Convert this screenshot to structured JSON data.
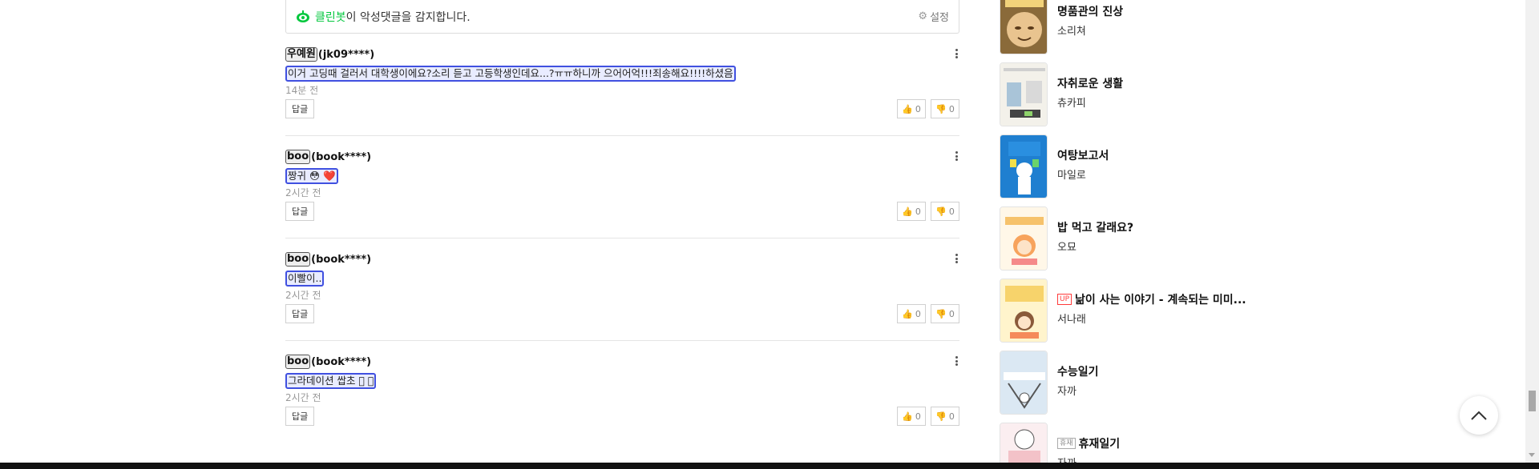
{
  "cleanbot": {
    "brand": "클린봇",
    "message": "이 악성댓글을 감지합니다.",
    "settings_label": "설정"
  },
  "comments": [
    {
      "nickname": "우예원",
      "user_id": "(jk09****)",
      "text": "이거 고딩때 걸러서 대학생이에요?소리 듣고 고등학생인데요...?ㅠㅠ하니까 으어어억!!!죄송해요!!!!하셨음",
      "time": "14분 전",
      "reply_label": "답글",
      "likes": "0",
      "dislikes": "0"
    },
    {
      "nickname": "boo",
      "user_id": "(book****)",
      "text": "짱귀 😳 ❤️",
      "time": "2시간 전",
      "reply_label": "답글",
      "likes": "0",
      "dislikes": "0"
    },
    {
      "nickname": "boo",
      "user_id": "(book****)",
      "text": "이빨이..",
      "time": "2시간 전",
      "reply_label": "답글",
      "likes": "0",
      "dislikes": "0"
    },
    {
      "nickname": "boo",
      "user_id": "(book****)",
      "text": "그라데이션 쌉초 🏻 🏼",
      "time": "2시간 전",
      "reply_label": "답글",
      "likes": "0",
      "dislikes": "0"
    }
  ],
  "side_list": [
    {
      "title": "명품관의 진상",
      "author": "소리쳐",
      "badge": ""
    },
    {
      "title": "자취로운 생활",
      "author": "츄카피",
      "badge": ""
    },
    {
      "title": "여탕보고서",
      "author": "마일로",
      "badge": ""
    },
    {
      "title": "밥 먹고 갈래요?",
      "author": "오묘",
      "badge": ""
    },
    {
      "title": "낢이 사는 이야기 - 계속되는 미미...",
      "author": "서나래",
      "badge": "UP"
    },
    {
      "title": "수능일기",
      "author": "자까",
      "badge": ""
    },
    {
      "title": "휴재일기",
      "author": "자까",
      "badge": "휴재"
    }
  ],
  "colors": {
    "brand_green": "#00c73c",
    "highlight_border": "#4050e0",
    "highlight_bg": "#e9ecff",
    "up_badge": "#ff3b3b"
  }
}
